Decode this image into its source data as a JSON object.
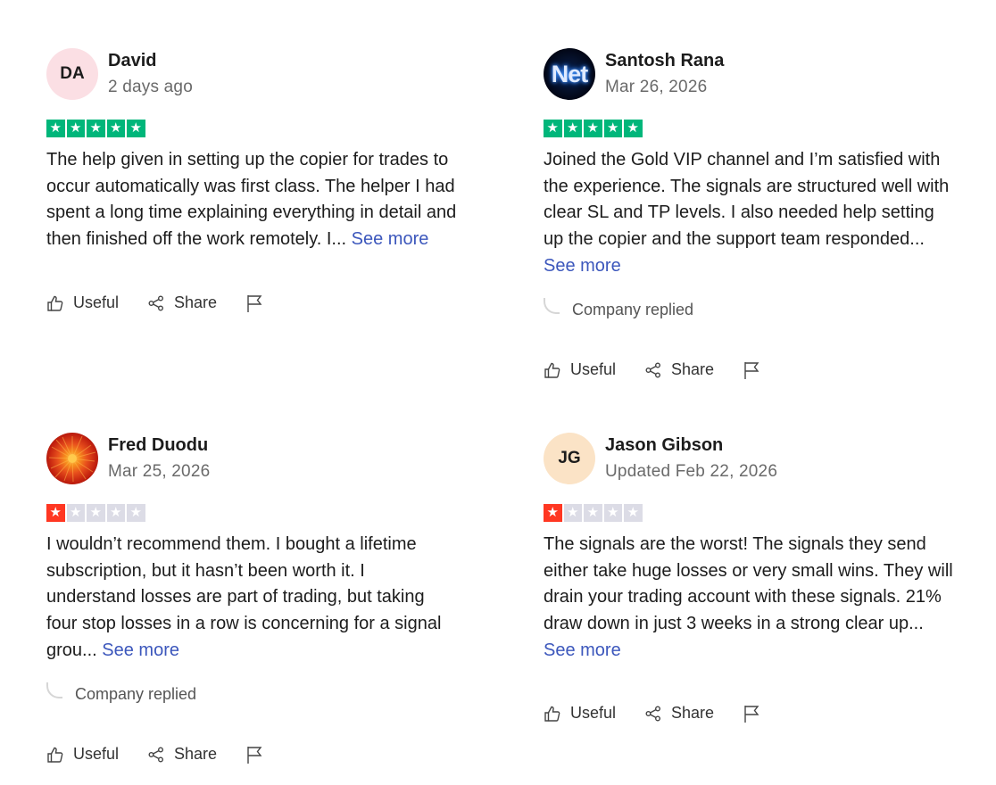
{
  "colors": {
    "star_green": "#00b67a",
    "star_red": "#ff3722",
    "star_empty": "#dcdce6",
    "link": "#3c57bc"
  },
  "actions": {
    "useful": "Useful",
    "share": "Share"
  },
  "reviews": [
    {
      "author": "David",
      "avatar_initials": "DA",
      "date": "2 days ago",
      "rating": 5,
      "text": "The help given in setting up the copier for trades to occur automatically was first class. The helper I had spent a long time explaining everything in detail and then finished off the work remotely. I...",
      "see_more": "See more",
      "company_replied": ""
    },
    {
      "author": "Santosh Rana",
      "avatar_initials": "Net",
      "date": "Mar 26, 2026",
      "rating": 5,
      "text": "Joined the Gold VIP channel and I’m satisfied with the experience. The signals are structured well with clear SL and TP levels. I also needed help setting up the copier and the support team responded...",
      "see_more": "See more",
      "company_replied": "Company replied"
    },
    {
      "author": "Fred Duodu",
      "avatar_initials": "",
      "date": "Mar 25, 2026",
      "rating": 1,
      "text": "I wouldn’t recommend them. I bought a lifetime subscription, but it hasn’t been worth it. I understand losses are part of trading, but taking four stop losses in a row is concerning for a signal grou...",
      "see_more": "See more",
      "company_replied": "Company replied"
    },
    {
      "author": "Jason Gibson",
      "avatar_initials": "JG",
      "date": "Updated Feb 22, 2026",
      "rating": 1,
      "text": "The signals are the worst! The signals they send either take huge losses or very small wins. They will drain your trading account with these signals. 21% draw down in just 3 weeks in a strong clear up...",
      "see_more": "See more",
      "company_replied": ""
    }
  ]
}
